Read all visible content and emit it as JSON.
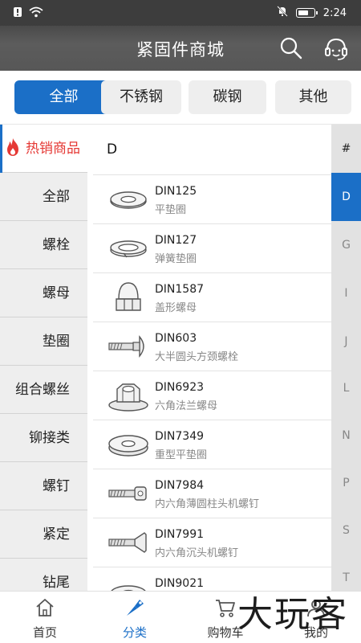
{
  "status_bar": {
    "time": "2:24"
  },
  "header": {
    "title": "紧固件商城"
  },
  "tabs": [
    {
      "label": "全部"
    },
    {
      "label": "不锈钢"
    },
    {
      "label": "碳钢"
    },
    {
      "label": "其他"
    }
  ],
  "sidebar": {
    "items": [
      {
        "label": "热销商品"
      },
      {
        "label": "全部"
      },
      {
        "label": "螺栓"
      },
      {
        "label": "螺母"
      },
      {
        "label": "垫圈"
      },
      {
        "label": "组合螺丝"
      },
      {
        "label": "铆接类"
      },
      {
        "label": "螺钉"
      },
      {
        "label": "紧定"
      },
      {
        "label": "钻尾"
      }
    ]
  },
  "list": {
    "section": "D",
    "items": [
      {
        "code": "DIN125",
        "desc": "平垫圈",
        "icon": "flat-washer-icon"
      },
      {
        "code": "DIN127",
        "desc": "弹簧垫圈",
        "icon": "spring-washer-icon"
      },
      {
        "code": "DIN1587",
        "desc": "盖形螺母",
        "icon": "cap-nut-icon"
      },
      {
        "code": "DIN603",
        "desc": "大半圆头方颈螺栓",
        "icon": "carriage-bolt-icon"
      },
      {
        "code": "DIN6923",
        "desc": "六角法兰螺母",
        "icon": "flange-nut-icon"
      },
      {
        "code": "DIN7349",
        "desc": "重型平垫圈",
        "icon": "heavy-washer-icon"
      },
      {
        "code": "DIN7984",
        "desc": "内六角薄圆柱头机螺钉",
        "icon": "socket-screw-icon"
      },
      {
        "code": "DIN7991",
        "desc": "内六角沉头机螺钉",
        "icon": "countersunk-screw-icon"
      },
      {
        "code": "DIN9021",
        "desc": "",
        "icon": "washer-icon"
      }
    ]
  },
  "index_bar": [
    "#",
    "D",
    "G",
    "I",
    "J",
    "L",
    "N",
    "P",
    "S",
    "T"
  ],
  "bottom_nav": [
    {
      "label": "首页",
      "icon": "home-icon"
    },
    {
      "label": "分类",
      "icon": "category-icon"
    },
    {
      "label": "购物车",
      "icon": "cart-icon"
    },
    {
      "label": "我的",
      "icon": "profile-icon"
    }
  ],
  "watermark": "大玩客",
  "colors": {
    "accent": "#1b6fc7",
    "hot": "#e53935",
    "header": "#555555"
  }
}
